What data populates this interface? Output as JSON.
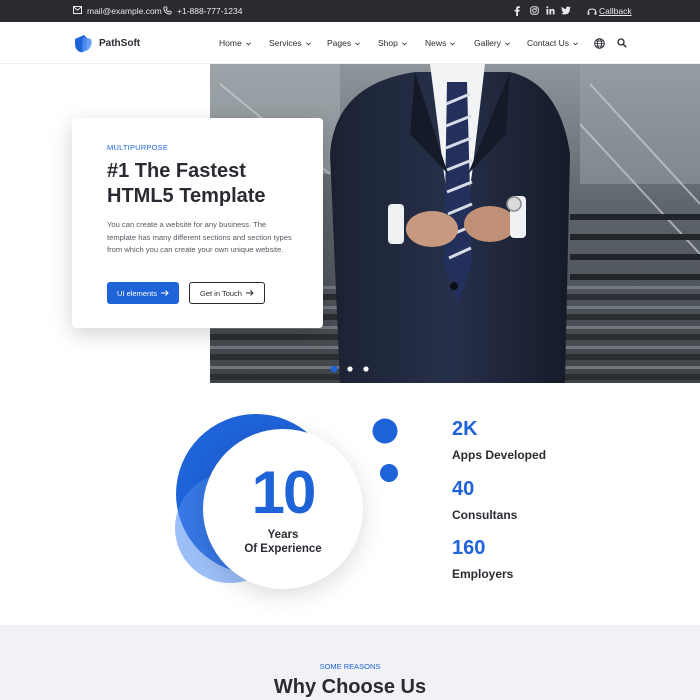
{
  "topbar": {
    "email": "mail@example.com",
    "phone": "+1-888-777-1234",
    "callback_label": "Callback",
    "social_icons": [
      "facebook-icon",
      "instagram-icon",
      "linkedin-icon",
      "twitter-icon"
    ]
  },
  "header": {
    "brand": "PathSoft",
    "nav": [
      {
        "label": "Home"
      },
      {
        "label": "Services"
      },
      {
        "label": "Pages"
      },
      {
        "label": "Shop"
      },
      {
        "label": "News"
      },
      {
        "label": "Gallery"
      },
      {
        "label": "Contact Us"
      }
    ]
  },
  "hero": {
    "kicker": "MULTIPURPOSE",
    "headline": "#1 The Fastest HTML5 Template",
    "description": "You can create a website for any business. The template has many different sections and section types from which you can create your own unique website.",
    "primary_button": "UI elements",
    "secondary_button": "Get in Touch",
    "slide_count": 3,
    "active_slide": 1
  },
  "stats": {
    "years_value": "10",
    "years_label_1": "Years",
    "years_label_2": "Of Experience",
    "items": [
      {
        "value": "2K",
        "label": "Apps Developed"
      },
      {
        "value": "40",
        "label": "Consultans"
      },
      {
        "value": "160",
        "label": "Employers"
      }
    ]
  },
  "reasons": {
    "kicker": "SOME REASONS",
    "title": "Why Choose Us"
  },
  "colors": {
    "accent": "#1f63d9",
    "topbar_bg": "#2a2a30",
    "text_dark": "#2b2b33",
    "section_bg": "#f0f2f6"
  }
}
